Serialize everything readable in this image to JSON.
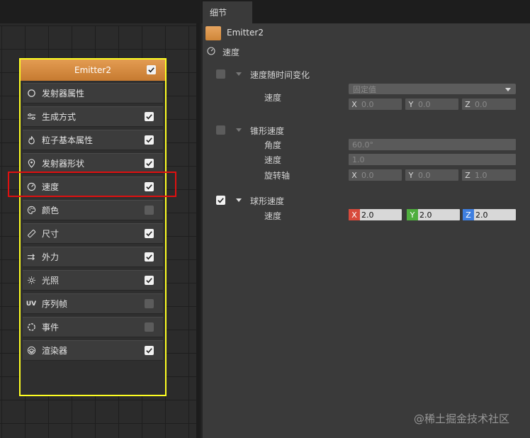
{
  "node": {
    "title": "Emitter2",
    "enabled": true,
    "modules": [
      {
        "label": "发射器属性",
        "icon": "circle-outline-icon",
        "has_checkbox": false
      },
      {
        "label": "生成方式",
        "icon": "sliders-icon",
        "has_checkbox": true,
        "checked": true
      },
      {
        "label": "粒子基本属性",
        "icon": "flame-icon",
        "has_checkbox": true,
        "checked": true
      },
      {
        "label": "发射器形状",
        "icon": "location-pin-icon",
        "has_checkbox": true,
        "checked": true
      },
      {
        "label": "速度",
        "icon": "speedometer-icon",
        "has_checkbox": true,
        "checked": true
      },
      {
        "label": "颜色",
        "icon": "palette-icon",
        "has_checkbox": true,
        "checked": false
      },
      {
        "label": "尺寸",
        "icon": "ruler-icon",
        "has_checkbox": true,
        "checked": true
      },
      {
        "label": "外力",
        "icon": "arrows-right-icon",
        "has_checkbox": true,
        "checked": true
      },
      {
        "label": "光照",
        "icon": "sun-icon",
        "has_checkbox": true,
        "checked": true
      },
      {
        "label": "序列帧",
        "icon": "uv-icon",
        "icon_text": "UV",
        "has_checkbox": true,
        "checked": false
      },
      {
        "label": "事件",
        "icon": "dashed-circle-icon",
        "has_checkbox": true,
        "checked": false
      },
      {
        "label": "渲染器",
        "icon": "render-layers-icon",
        "has_checkbox": true,
        "checked": true
      }
    ],
    "highlighted_module": "速度"
  },
  "panel": {
    "tab": "细节",
    "emitter_name": "Emitter2",
    "module_name": "速度",
    "sections": {
      "over_time": {
        "title": "速度随时间变化",
        "checked": false,
        "speed_label": "速度",
        "mode_placeholder": "固定值",
        "x": "0.0",
        "y": "0.0",
        "z": "0.0"
      },
      "cone": {
        "title": "锥形速度",
        "checked": false,
        "angle_label": "角度",
        "angle_value": "60.0°",
        "speed_label": "速度",
        "speed_value": "1.0",
        "axis_label": "旋转轴",
        "x": "0.0",
        "y": "0.0",
        "z": "1.0"
      },
      "sphere": {
        "title": "球形速度",
        "checked": true,
        "speed_label": "速度",
        "x": "2.0",
        "y": "2.0",
        "z": "2.0"
      }
    },
    "axis_labels": {
      "x": "X",
      "y": "Y",
      "z": "Z"
    }
  },
  "watermark": "@稀土掘金技术社区",
  "colors": {
    "node_border": "#ffff22",
    "node_header": "#d98a3f",
    "highlight_box": "#e01010",
    "axis_x": "#d84a3c",
    "axis_y": "#4fae3e",
    "axis_z": "#3f7fe0"
  }
}
